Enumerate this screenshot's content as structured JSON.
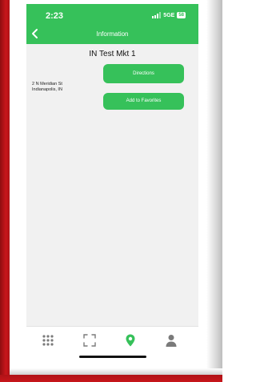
{
  "status_bar": {
    "time": "2:23",
    "network": "5GE",
    "battery": "58"
  },
  "header": {
    "title": "Information",
    "back_icon": "chevron-left-icon"
  },
  "place": {
    "name": "IN Test Mkt 1",
    "address_line1": "2 N Meridian St",
    "address_line2": "Indianapolis, IN"
  },
  "actions": {
    "directions_label": "Directions",
    "favorites_label": "Add to Favorites"
  },
  "tabbar": {
    "items": [
      {
        "icon": "grid-icon",
        "active": false
      },
      {
        "icon": "scan-icon",
        "active": false
      },
      {
        "icon": "map-pin-icon",
        "active": true
      },
      {
        "icon": "person-icon",
        "active": false
      }
    ]
  },
  "colors": {
    "brand": "#36c15a",
    "background": "#f1f1f1",
    "frame_red": "#c8161b"
  }
}
